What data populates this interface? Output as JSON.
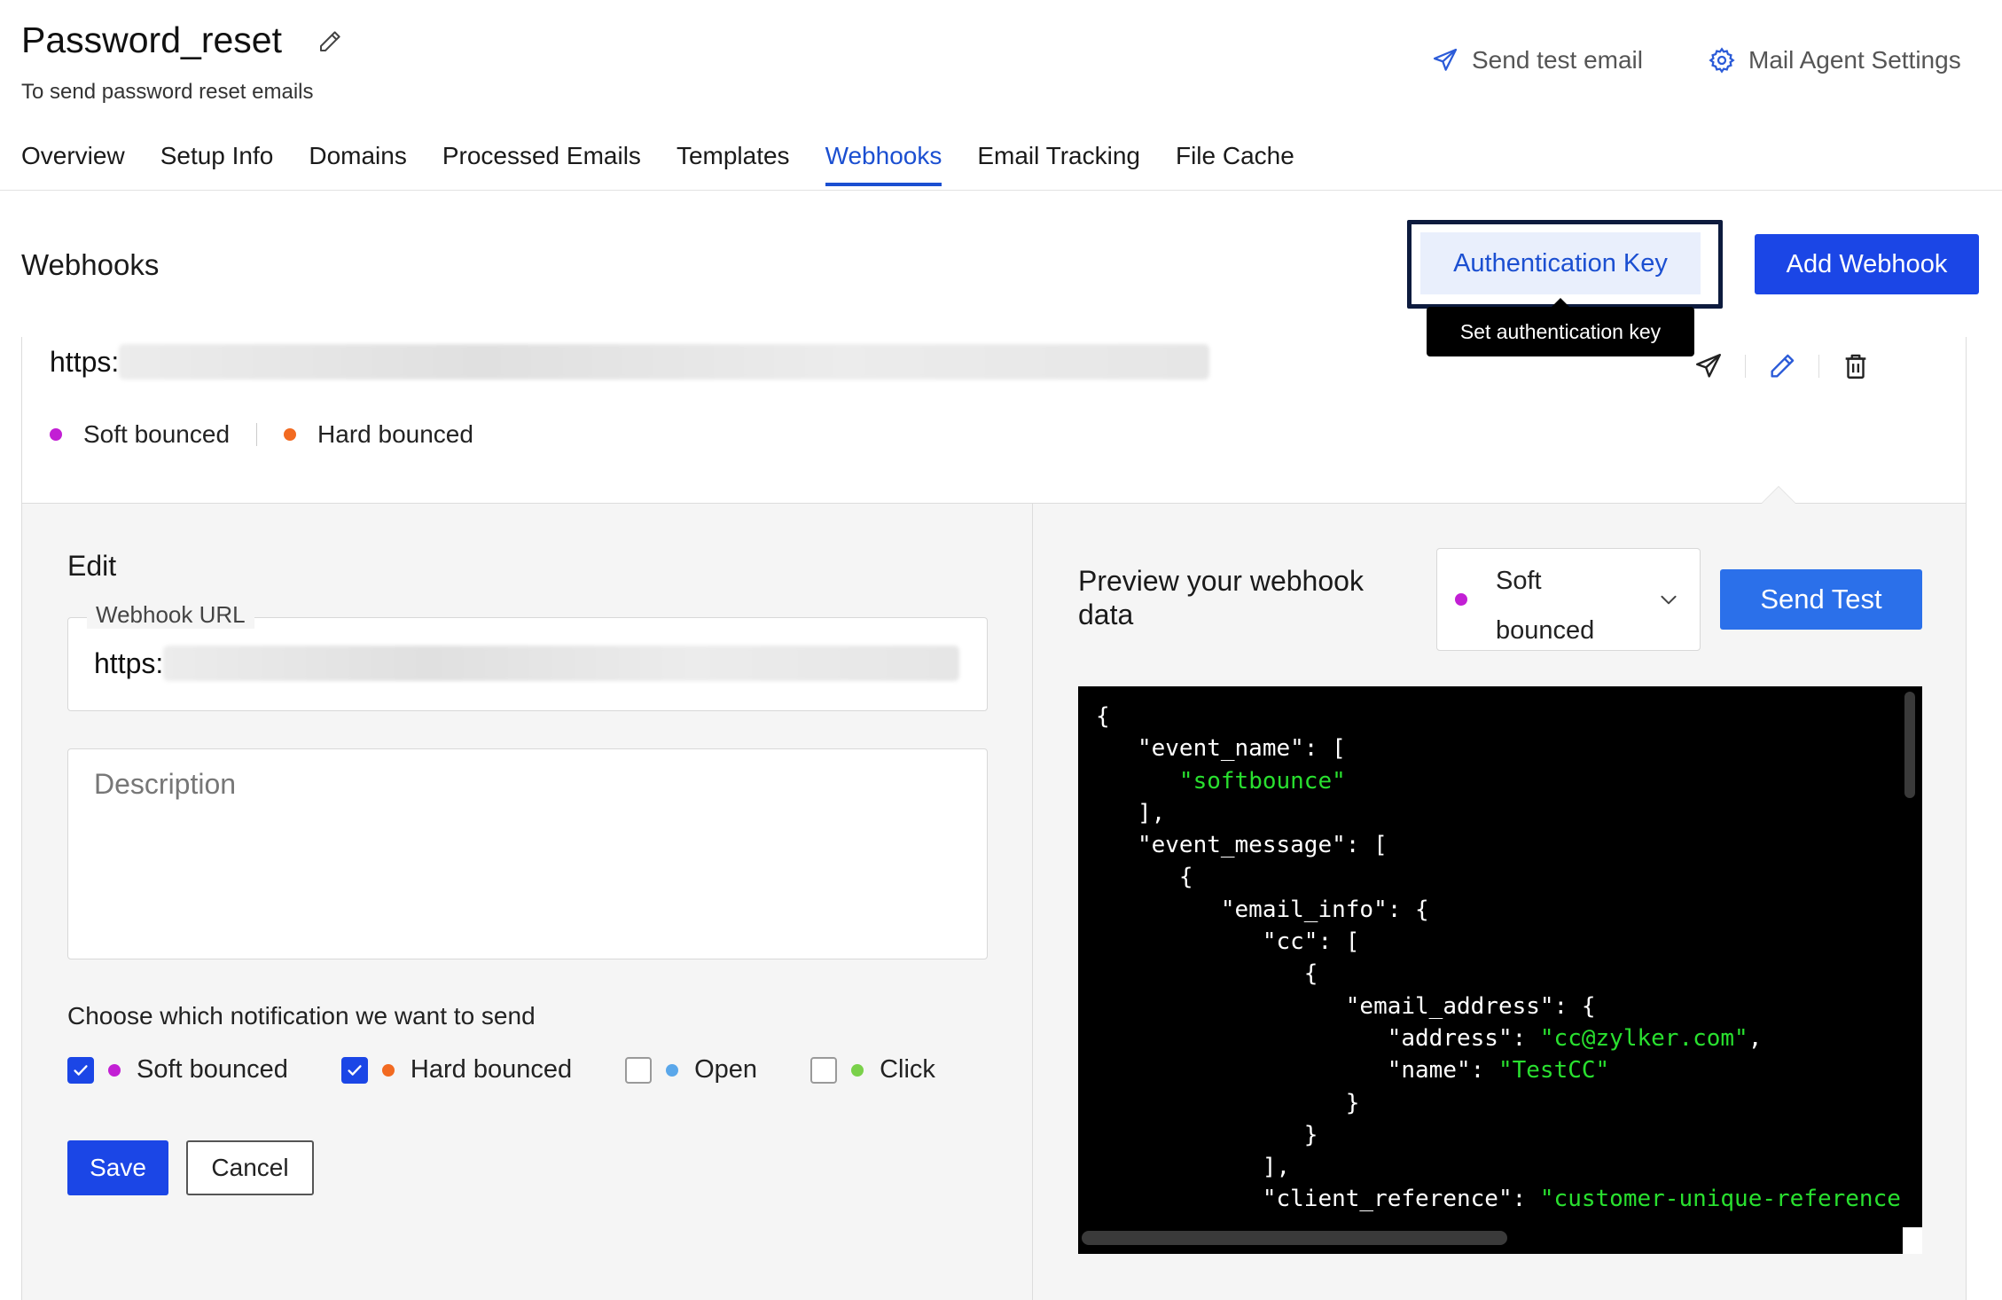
{
  "header": {
    "title": "Password_reset",
    "subtitle": "To send password reset emails",
    "actions": {
      "send_test_email": "Send test email",
      "mail_agent_settings": "Mail Agent Settings"
    }
  },
  "tabs": [
    {
      "label": "Overview",
      "active": false
    },
    {
      "label": "Setup Info",
      "active": false
    },
    {
      "label": "Domains",
      "active": false
    },
    {
      "label": "Processed Emails",
      "active": false
    },
    {
      "label": "Templates",
      "active": false
    },
    {
      "label": "Webhooks",
      "active": true
    },
    {
      "label": "Email Tracking",
      "active": false
    },
    {
      "label": "File Cache",
      "active": false
    }
  ],
  "section": {
    "title": "Webhooks",
    "auth_key_label": "Authentication Key",
    "tooltip": "Set authentication key",
    "add_webhook_label": "Add Webhook"
  },
  "webhook": {
    "url_prefix": "https:",
    "tags": {
      "soft": "Soft bounced",
      "hard": "Hard bounced"
    }
  },
  "edit": {
    "title": "Edit",
    "url_label": "Webhook URL",
    "url_prefix": "https:",
    "description_placeholder": "Description",
    "notification_title": "Choose which notification we want to send",
    "options": {
      "soft": {
        "label": "Soft bounced",
        "checked": true
      },
      "hard": {
        "label": "Hard bounced",
        "checked": true
      },
      "open": {
        "label": "Open",
        "checked": false
      },
      "click": {
        "label": "Click",
        "checked": false
      }
    },
    "save_label": "Save",
    "cancel_label": "Cancel"
  },
  "preview": {
    "title": "Preview your webhook data",
    "selected_event": "Soft bounced",
    "send_test_label": "Send Test",
    "code_lines": [
      [
        {
          "t": "{"
        }
      ],
      [
        {
          "t": "   \"event_name\": ["
        }
      ],
      [
        {
          "t": "      "
        },
        {
          "t": "\"softbounce\"",
          "s": true
        }
      ],
      [
        {
          "t": "   ],"
        }
      ],
      [
        {
          "t": "   \"event_message\": ["
        }
      ],
      [
        {
          "t": "      {"
        }
      ],
      [
        {
          "t": "         \"email_info\": {"
        }
      ],
      [
        {
          "t": "            \"cc\": ["
        }
      ],
      [
        {
          "t": "               {"
        }
      ],
      [
        {
          "t": "                  \"email_address\": {"
        }
      ],
      [
        {
          "t": "                     \"address\": "
        },
        {
          "t": "\"cc@zylker.com\"",
          "s": true
        },
        {
          "t": ","
        }
      ],
      [
        {
          "t": "                     \"name\": "
        },
        {
          "t": "\"TestCC\"",
          "s": true
        }
      ],
      [
        {
          "t": "                  }"
        }
      ],
      [
        {
          "t": "               }"
        }
      ],
      [
        {
          "t": "            ],"
        }
      ],
      [
        {
          "t": "            \"client_reference\": "
        },
        {
          "t": "\"customer-unique-reference",
          "s": true
        }
      ]
    ]
  },
  "colors": {
    "accent": "#1b4fd1",
    "primary_button": "#1b46e6",
    "send_test_button": "#2b70ea",
    "soft_dot": "#c21fd4",
    "hard_dot": "#f26a21",
    "open_dot": "#5aa7ea",
    "click_dot": "#7ad14a",
    "code_string": "#29e02f"
  }
}
